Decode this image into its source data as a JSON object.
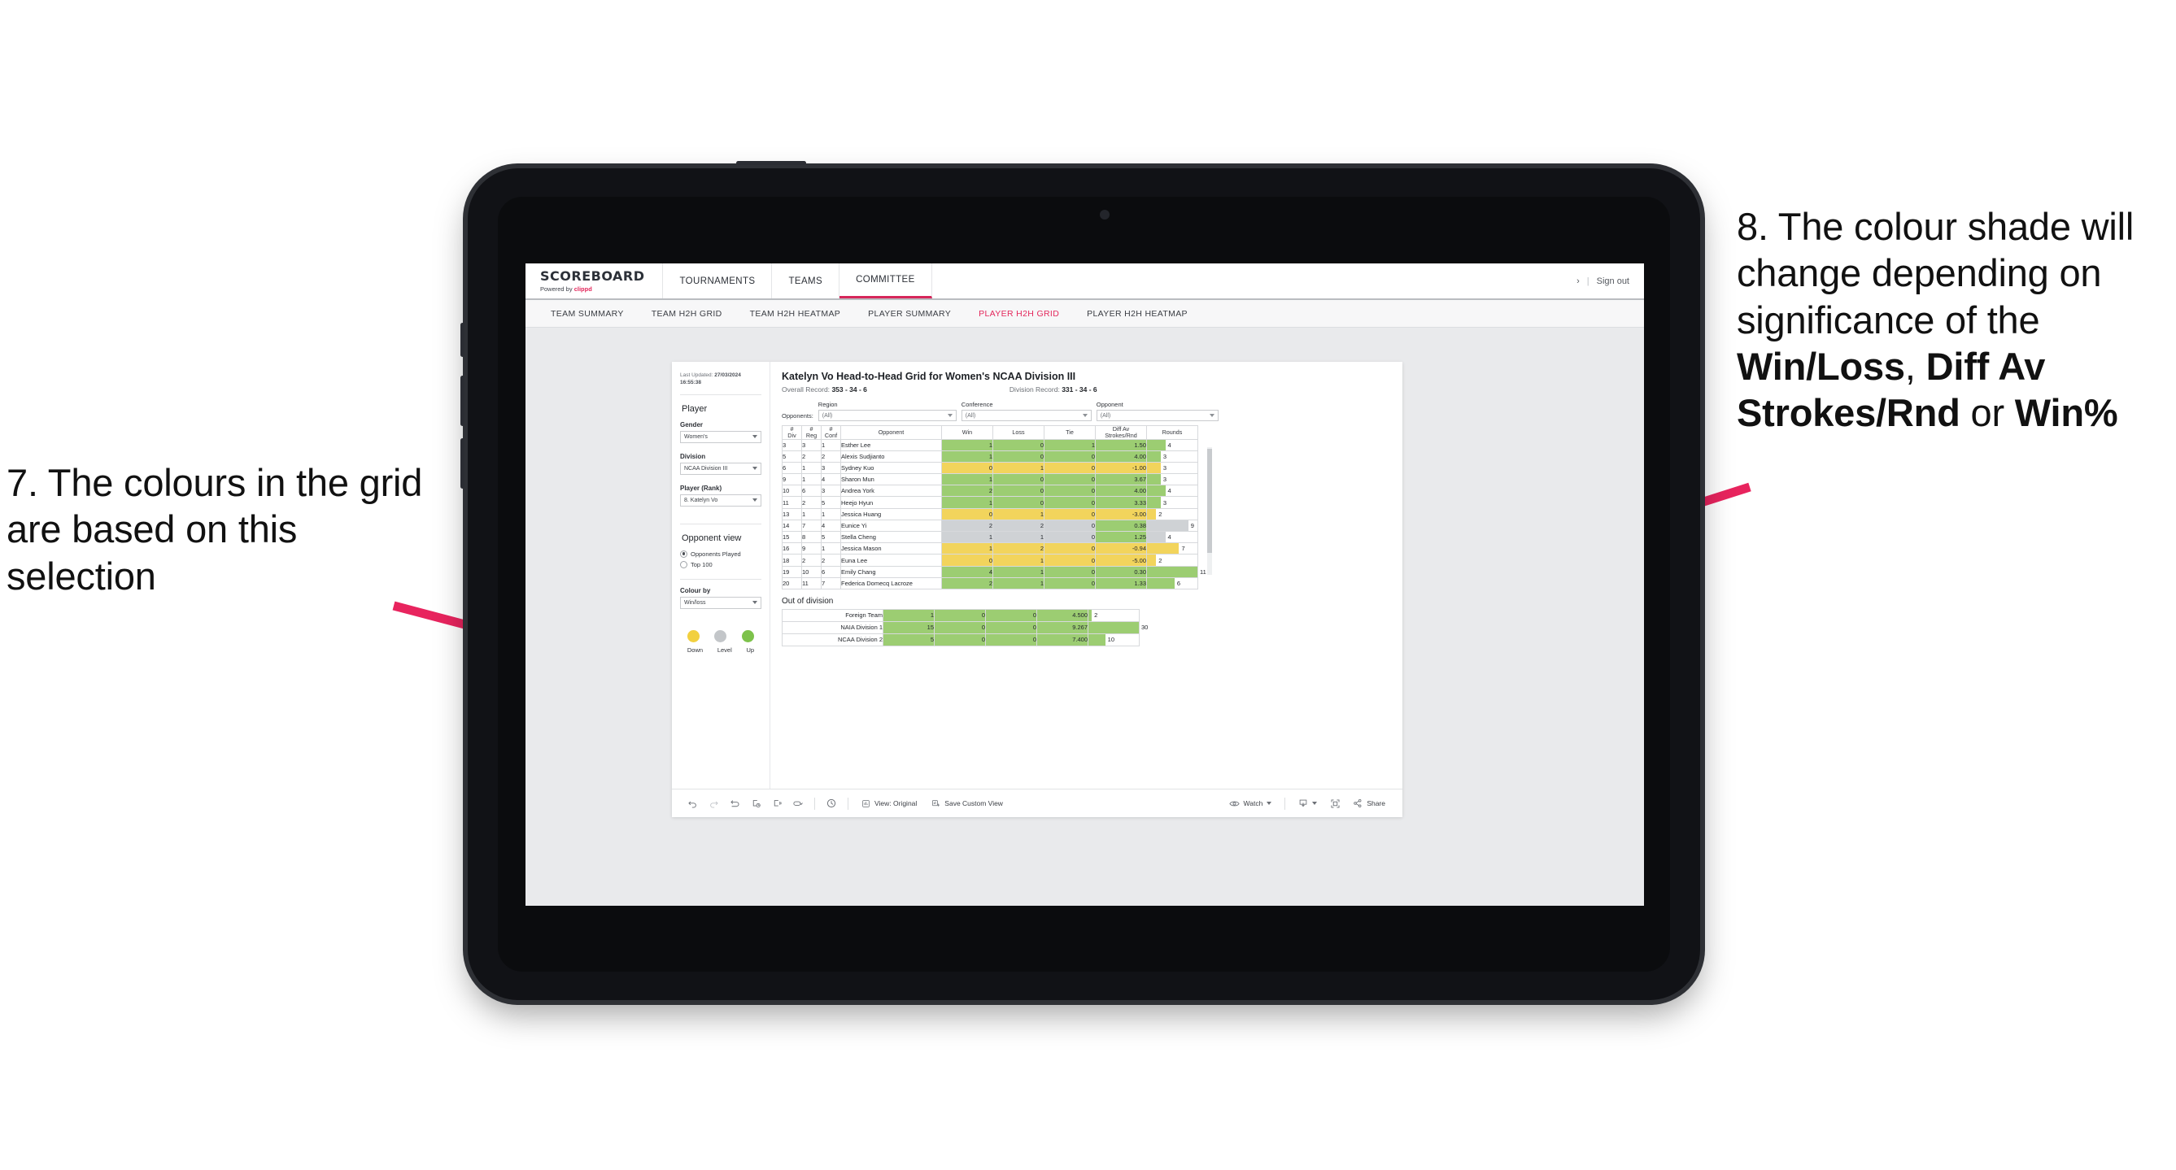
{
  "annotations": {
    "left": "7. The colours in the grid are based on this selection",
    "right_parts": [
      {
        "t": "8. The colour shade will change depending on significance of the ",
        "b": false
      },
      {
        "t": "Win/Loss",
        "b": true
      },
      {
        "t": ", ",
        "b": false
      },
      {
        "t": "Diff Av Strokes/Rnd",
        "b": true
      },
      {
        "t": " or ",
        "b": false
      },
      {
        "t": "Win%",
        "b": true
      }
    ],
    "arrow_color": "#e8245e"
  },
  "app": {
    "brand": {
      "name": "SCOREBOARD",
      "powered_prefix": "Powered by ",
      "powered_brand": "clippd"
    },
    "nav_tabs": [
      {
        "label": "TOURNAMENTS",
        "active": false
      },
      {
        "label": "TEAMS",
        "active": false
      },
      {
        "label": "COMMITTEE",
        "active": true
      }
    ],
    "top_right": {
      "chevron": "›",
      "divider": "|",
      "sign_out": "Sign out"
    },
    "sub_tabs": [
      {
        "label": "TEAM SUMMARY",
        "active": false
      },
      {
        "label": "TEAM H2H GRID",
        "active": false
      },
      {
        "label": "TEAM H2H HEATMAP",
        "active": false
      },
      {
        "label": "PLAYER SUMMARY",
        "active": false
      },
      {
        "label": "PLAYER H2H GRID",
        "active": true
      },
      {
        "label": "PLAYER H2H HEATMAP",
        "active": false
      }
    ]
  },
  "sidebar": {
    "last_updated_label": "Last Updated:",
    "last_updated_value": "27/03/2024 16:55:38",
    "section_player": "Player",
    "gender": {
      "label": "Gender",
      "value": "Women's"
    },
    "division": {
      "label": "Division",
      "value": "NCAA Division III"
    },
    "player_rank": {
      "label": "Player (Rank)",
      "value": "8. Katelyn Vo"
    },
    "opponent_view": {
      "title": "Opponent view",
      "options": [
        {
          "label": "Opponents Played",
          "selected": true
        },
        {
          "label": "Top 100",
          "selected": false
        }
      ]
    },
    "colour_by": {
      "label": "Colour by",
      "value": "Win/loss"
    },
    "legend": [
      {
        "label": "Down",
        "color": "#f2d03f"
      },
      {
        "label": "Level",
        "color": "#c3c6c9"
      },
      {
        "label": "Up",
        "color": "#7dc24b"
      }
    ]
  },
  "viz": {
    "title": "Katelyn Vo Head-to-Head Grid for Women's NCAA Division III",
    "overall_record_label": "Overall Record:",
    "overall_record_value": "353 -  34 - 6",
    "division_record_label": "Division Record:",
    "division_record_value": "331 -  34 - 6",
    "opponents_label": "Opponents:",
    "filters": [
      {
        "caption": "Region",
        "value": "(All)"
      },
      {
        "caption": "Conference",
        "value": "(All)"
      },
      {
        "caption": "Opponent",
        "value": "(All)"
      }
    ],
    "out_of_division_title": "Out of division"
  },
  "chart_data": {
    "type": "table",
    "title": "Katelyn Vo Head-to-Head Grid for Women's NCAA Division III",
    "columns": [
      "# Div",
      "# Reg",
      "# Conf",
      "Opponent",
      "Win",
      "Loss",
      "Tie",
      "Diff Av Strokes/Rnd",
      "Rounds"
    ],
    "column_header_lines": [
      [
        "#",
        "Div"
      ],
      [
        "#",
        "Reg"
      ],
      [
        "#",
        "Conf"
      ],
      [
        "Opponent"
      ],
      [
        "Win"
      ],
      [
        "Loss"
      ],
      [
        "Tie"
      ],
      [
        "Diff Av",
        "Strokes/Rnd"
      ],
      [
        "Rounds"
      ]
    ],
    "rounds_max": 11,
    "colors": {
      "up": "#9ccd72",
      "down": "#f2d45c",
      "level": "#cfd2d5",
      "grid_border": "#d7d9dc"
    },
    "rows": [
      {
        "div": "3",
        "reg": "3",
        "conf": "1",
        "opponent": "Esther Lee",
        "win": "1",
        "loss": "0",
        "tie": "1",
        "diff": "1.50",
        "rounds": 4,
        "state": "up"
      },
      {
        "div": "5",
        "reg": "2",
        "conf": "2",
        "opponent": "Alexis Sudjianto",
        "win": "1",
        "loss": "0",
        "tie": "0",
        "diff": "4.00",
        "rounds": 3,
        "state": "up"
      },
      {
        "div": "6",
        "reg": "1",
        "conf": "3",
        "opponent": "Sydney Kuo",
        "win": "0",
        "loss": "1",
        "tie": "0",
        "diff": "-1.00",
        "rounds": 3,
        "state": "down"
      },
      {
        "div": "9",
        "reg": "1",
        "conf": "4",
        "opponent": "Sharon Mun",
        "win": "1",
        "loss": "0",
        "tie": "0",
        "diff": "3.67",
        "rounds": 3,
        "state": "up"
      },
      {
        "div": "10",
        "reg": "6",
        "conf": "3",
        "opponent": "Andrea York",
        "win": "2",
        "loss": "0",
        "tie": "0",
        "diff": "4.00",
        "rounds": 4,
        "state": "up"
      },
      {
        "div": "11",
        "reg": "2",
        "conf": "5",
        "opponent": "Heejo Hyun",
        "win": "1",
        "loss": "0",
        "tie": "0",
        "diff": "3.33",
        "rounds": 3,
        "state": "up"
      },
      {
        "div": "13",
        "reg": "1",
        "conf": "1",
        "opponent": "Jessica Huang",
        "win": "0",
        "loss": "1",
        "tie": "0",
        "diff": "-3.00",
        "rounds": 2,
        "state": "down"
      },
      {
        "div": "14",
        "reg": "7",
        "conf": "4",
        "opponent": "Eunice Yi",
        "win": "2",
        "loss": "2",
        "tie": "0",
        "diff": "0.38",
        "rounds": 9,
        "state": "level",
        "diff_state": "up"
      },
      {
        "div": "15",
        "reg": "8",
        "conf": "5",
        "opponent": "Stella Cheng",
        "win": "1",
        "loss": "1",
        "tie": "0",
        "diff": "1.25",
        "rounds": 4,
        "state": "level",
        "diff_state": "up"
      },
      {
        "div": "16",
        "reg": "9",
        "conf": "1",
        "opponent": "Jessica Mason",
        "win": "1",
        "loss": "2",
        "tie": "0",
        "diff": "-0.94",
        "rounds": 7,
        "state": "down"
      },
      {
        "div": "18",
        "reg": "2",
        "conf": "2",
        "opponent": "Euna Lee",
        "win": "0",
        "loss": "1",
        "tie": "0",
        "diff": "-5.00",
        "rounds": 2,
        "state": "down"
      },
      {
        "div": "19",
        "reg": "10",
        "conf": "6",
        "opponent": "Emily Chang",
        "win": "4",
        "loss": "1",
        "tie": "0",
        "diff": "0.30",
        "rounds": 11,
        "state": "up"
      },
      {
        "div": "20",
        "reg": "11",
        "conf": "7",
        "opponent": "Federica Domecq Lacroze",
        "win": "2",
        "loss": "1",
        "tie": "0",
        "diff": "1.33",
        "rounds": 6,
        "state": "up"
      }
    ],
    "out_of_division": {
      "rounds_max": 30,
      "rows": [
        {
          "name": "Foreign Team",
          "win": "1",
          "loss": "0",
          "tie": "0",
          "diff": "4.500",
          "rounds": 2,
          "state": "up"
        },
        {
          "name": "NAIA Division 1",
          "win": "15",
          "loss": "0",
          "tie": "0",
          "diff": "9.267",
          "rounds": 30,
          "state": "up"
        },
        {
          "name": "NCAA Division 2",
          "win": "5",
          "loss": "0",
          "tie": "0",
          "diff": "7.400",
          "rounds": 10,
          "state": "up"
        }
      ]
    }
  },
  "toolbar": {
    "icons": [
      "undo-icon",
      "redo-icon",
      "revert-icon",
      "refresh-icon",
      "pause-icon",
      "zoom-icon",
      "history-icon"
    ],
    "view_label": "View: Original",
    "save_custom_view_label": "Save Custom View",
    "watch_label": "Watch",
    "share_label": "Share"
  }
}
